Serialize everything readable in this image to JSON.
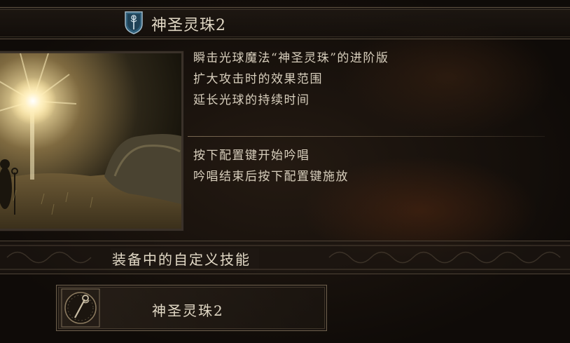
{
  "header": {
    "title": "神圣灵珠2",
    "icon": "blue-shield-staff-icon"
  },
  "preview": {
    "icon": "holy-light-orb-scene"
  },
  "description": {
    "lines": [
      "瞬击光球魔法“神圣灵珠”的进阶版",
      "扩大攻击时的效果范围",
      "延长光球的持续时间"
    ],
    "usage": [
      "按下配置键开始吟唱",
      "吟唱结束后按下配置键施放"
    ]
  },
  "equipped": {
    "title": "装备中的自定义技能",
    "slot": {
      "label": "神圣灵珠2",
      "icon": "staff-ring-icon"
    }
  },
  "colors": {
    "text": "#d8cfbd",
    "frame": "#6e604d",
    "background": "#140f0b"
  }
}
